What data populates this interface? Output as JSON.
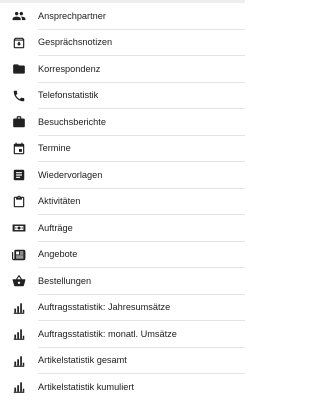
{
  "menu": {
    "items": [
      {
        "label": "Ansprechpartner",
        "icon": "contacts-icon"
      },
      {
        "label": "Gesprächsnotizen",
        "icon": "inbox-tray-icon"
      },
      {
        "label": "Korrespondenz",
        "icon": "folder-icon"
      },
      {
        "label": "Telefonstatistik",
        "icon": "phone-icon"
      },
      {
        "label": "Besuchsberichte",
        "icon": "briefcase-icon"
      },
      {
        "label": "Termine",
        "icon": "calendar-icon"
      },
      {
        "label": "Wiedervorlagen",
        "icon": "document-lines-icon"
      },
      {
        "label": "Aktivitäten",
        "icon": "clipboard-icon"
      },
      {
        "label": "Aufträge",
        "icon": "money-icon"
      },
      {
        "label": "Angebote",
        "icon": "newspaper-icon"
      },
      {
        "label": "Bestellungen",
        "icon": "basket-icon"
      },
      {
        "label": "Auftragsstatistik: Jahresumsätze",
        "icon": "bar-chart-icon"
      },
      {
        "label": "Auftragsstatistik: monatl. Umsätze",
        "icon": "bar-chart-icon"
      },
      {
        "label": "Artikelstatistik gesamt",
        "icon": "bar-chart-icon"
      },
      {
        "label": "Artikelstatistik kumuliert",
        "icon": "bar-chart-icon"
      }
    ]
  }
}
